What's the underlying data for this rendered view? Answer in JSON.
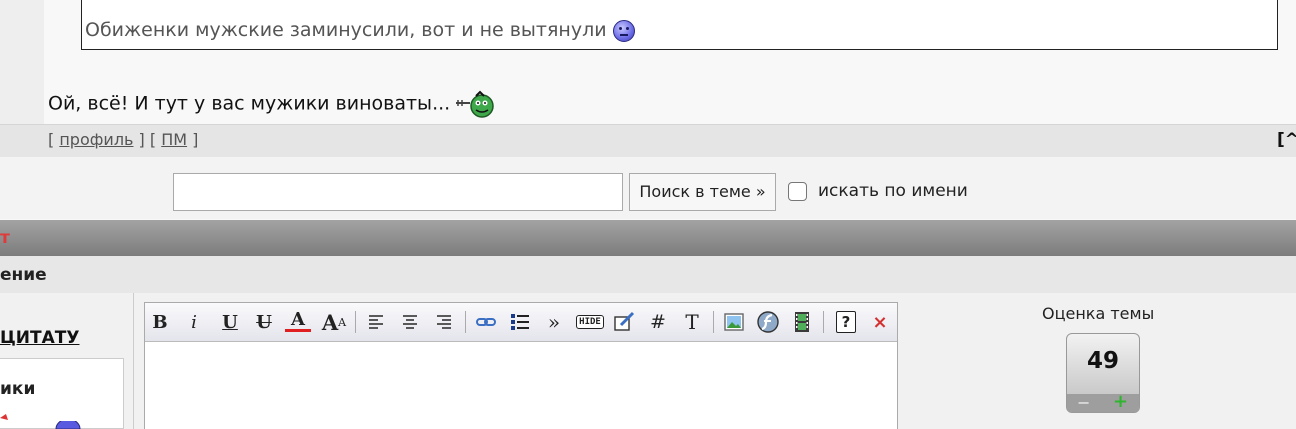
{
  "post": {
    "quote_text": "Обиженки мужские заминусили, вот и не вытянули",
    "reply_text": "Ой, всё! И тут у вас мужики виноваты...",
    "footer": {
      "bracket_open": "[ ",
      "bracket_mid": " ] [ ",
      "bracket_close": " ]",
      "profile_label": "профиль",
      "pm_label": "ПМ",
      "top_label": "[^"
    }
  },
  "search": {
    "input_value": "",
    "button_label": "Поиск в теме »",
    "checkbox_label": "искать по имени"
  },
  "reply_form": {
    "section_title": "т",
    "subheader": "ение",
    "quote_link": "ЦИТАТУ",
    "smiles_title": "ики",
    "toolbar": {
      "bold": "B",
      "italic": "i",
      "underline": "U",
      "strike": "U",
      "color": "A",
      "size": "A",
      "quote": "»",
      "hide": "HIDE",
      "hash": "#",
      "font": "T",
      "help": "?",
      "close": "×"
    }
  },
  "rating": {
    "label": "Оценка темы",
    "value": "49",
    "minus": "−",
    "plus": "+"
  },
  "colors": {
    "section_bar_text": "#e03a3a",
    "plus_green": "#2fb52f"
  }
}
